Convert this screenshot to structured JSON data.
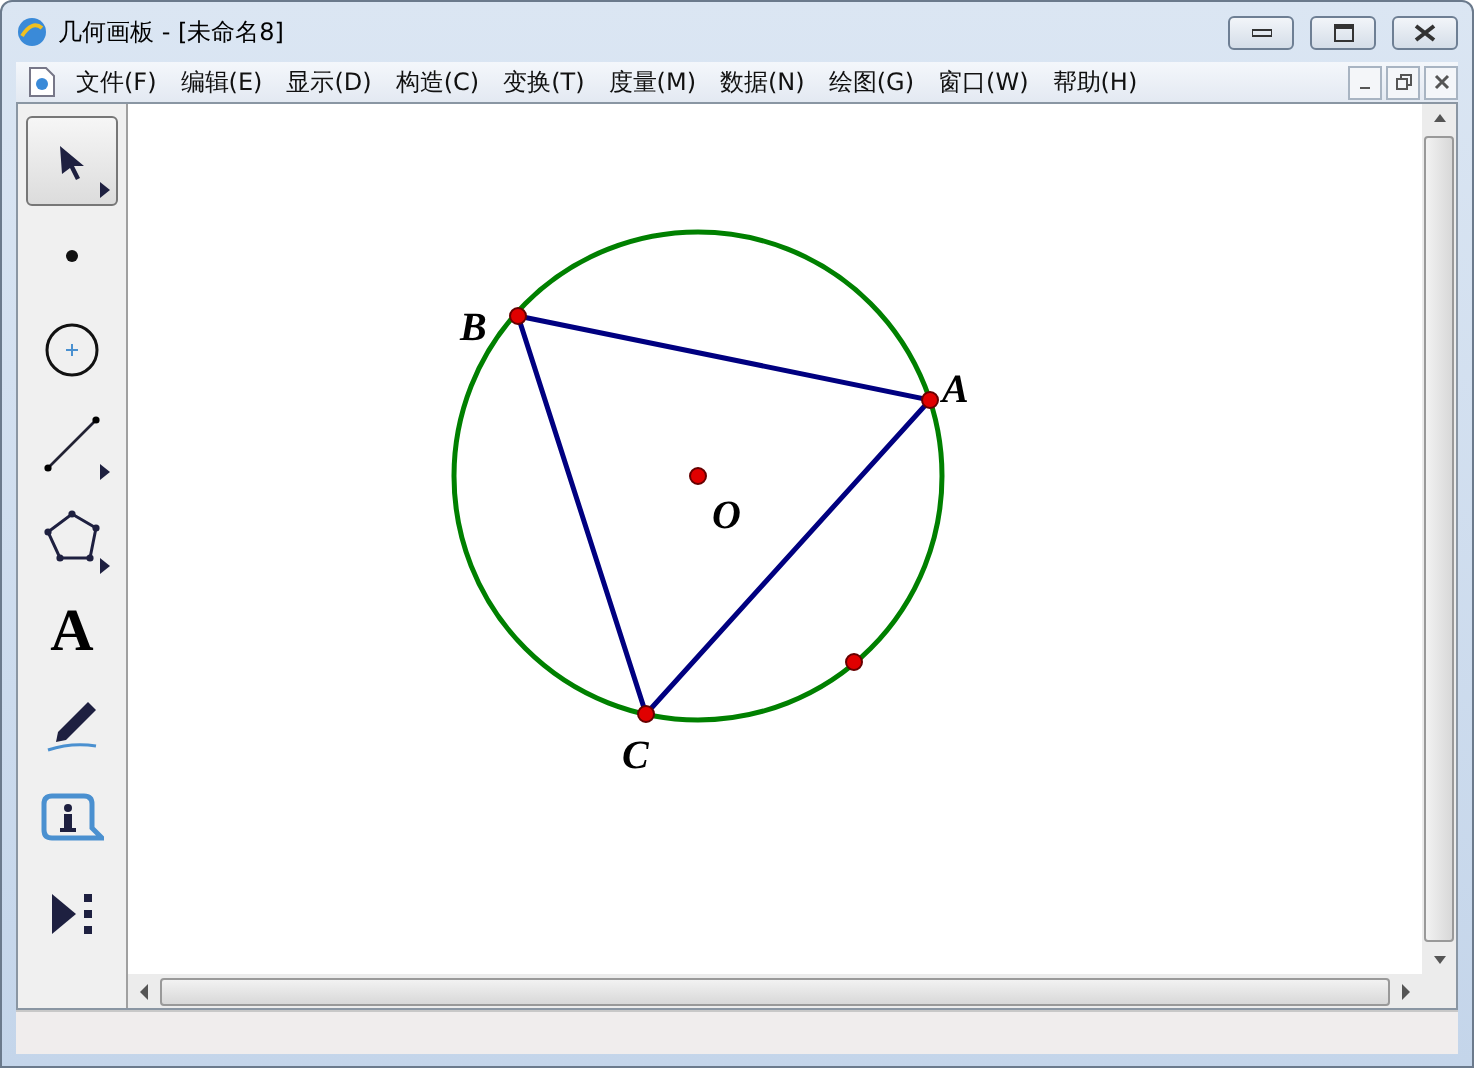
{
  "window": {
    "title": "几何画板 - [未命名8]"
  },
  "menu": [
    "文件(F)",
    "编辑(E)",
    "显示(D)",
    "构造(C)",
    "变换(T)",
    "度量(M)",
    "数据(N)",
    "绘图(G)",
    "窗口(W)",
    "帮助(H)"
  ],
  "tools": [
    {
      "kind": "arrow",
      "selected": true,
      "submenu": true
    },
    {
      "kind": "point",
      "selected": false,
      "submenu": false
    },
    {
      "kind": "compass",
      "selected": false,
      "submenu": false
    },
    {
      "kind": "segment",
      "selected": false,
      "submenu": true
    },
    {
      "kind": "polygon",
      "selected": false,
      "submenu": true
    },
    {
      "kind": "text",
      "selected": false,
      "submenu": false,
      "label": "A"
    },
    {
      "kind": "marker",
      "selected": false,
      "submenu": false
    },
    {
      "kind": "info",
      "selected": false,
      "submenu": false
    },
    {
      "kind": "custom",
      "selected": false,
      "submenu": false
    }
  ],
  "sketch": {
    "points": [
      {
        "label": "B",
        "label_shown": true
      },
      {
        "label": "A",
        "label_shown": true
      },
      {
        "label": "C",
        "label_shown": true
      },
      {
        "label": "O",
        "label_shown": true
      },
      {
        "label_shown": false
      }
    ]
  }
}
